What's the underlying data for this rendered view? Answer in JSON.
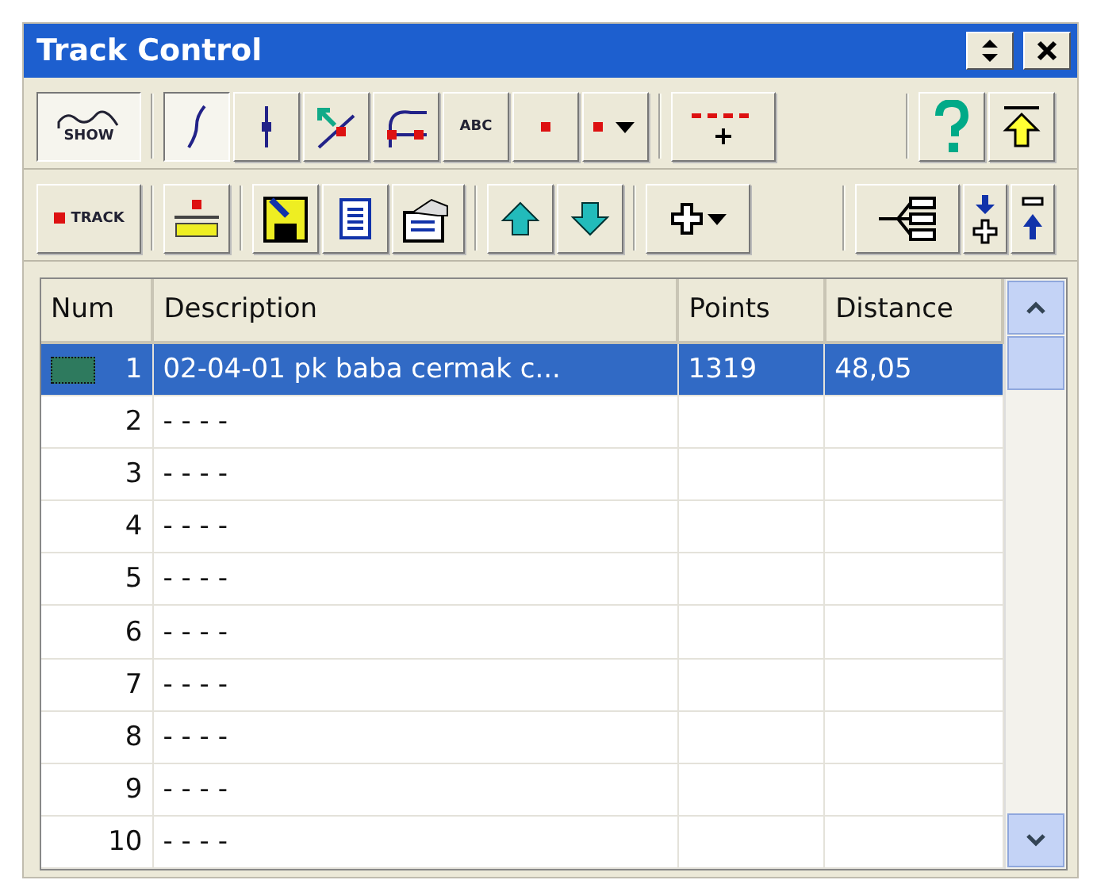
{
  "window": {
    "title": "Track Control",
    "controls": [
      {
        "kind": "updown"
      },
      {
        "kind": "close"
      }
    ]
  },
  "toolbars": [
    [
      [
        {
          "kind": "show",
          "label": "SHOW",
          "pressed": true
        }
      ],
      [
        {
          "kind": "curve",
          "pressed": true
        },
        {
          "kind": "split",
          "pressed": false
        },
        {
          "kind": "cross",
          "pressed": false
        },
        {
          "kind": "branch",
          "pressed": false
        },
        {
          "kind": "text",
          "label": "ABC",
          "pressed": false
        },
        {
          "kind": "dot",
          "pressed": false
        },
        {
          "kind": "dotdrop",
          "pressed": false
        }
      ],
      [
        {
          "kind": "join",
          "pressed": false
        }
      ],
      [
        {
          "kind": "help",
          "pressed": false
        },
        {
          "kind": "totop",
          "pressed": false
        }
      ]
    ],
    [
      [
        {
          "kind": "track",
          "label": "TRACK",
          "pressed": false
        }
      ],
      [
        {
          "kind": "ruler",
          "pressed": false
        }
      ],
      [
        {
          "kind": "save",
          "pressed": false
        },
        {
          "kind": "list",
          "pressed": false
        },
        {
          "kind": "props",
          "pressed": false
        }
      ],
      [
        {
          "kind": "up",
          "pressed": false
        },
        {
          "kind": "down",
          "pressed": false
        }
      ],
      [
        {
          "kind": "plusdrop",
          "pressed": false
        }
      ],
      [
        {
          "kind": "tree",
          "pressed": false
        },
        {
          "kind": "adddown",
          "pressed": false
        },
        {
          "kind": "subup",
          "pressed": false
        }
      ]
    ]
  ],
  "table": {
    "columns": [
      "Num",
      "Description",
      "Points",
      "Distance"
    ],
    "rows": [
      {
        "num": "1",
        "description": "02-04-01 pk baba cermak c...",
        "points": "1319",
        "distance": "48,05",
        "selected": true,
        "color": "#2e7a5e"
      },
      {
        "num": "2",
        "description": "- - - -",
        "selected": false
      },
      {
        "num": "3",
        "description": "- - - -",
        "selected": false
      },
      {
        "num": "4",
        "description": "- - - -",
        "selected": false
      },
      {
        "num": "5",
        "description": "- - - -",
        "selected": false
      },
      {
        "num": "6",
        "description": "- - - -",
        "selected": false
      },
      {
        "num": "7",
        "description": "- - - -",
        "selected": false
      },
      {
        "num": "8",
        "description": "- - - -",
        "selected": false
      },
      {
        "num": "9",
        "description": "- - - -",
        "selected": false
      },
      {
        "num": "10",
        "description": "- - - -",
        "selected": false
      }
    ]
  }
}
